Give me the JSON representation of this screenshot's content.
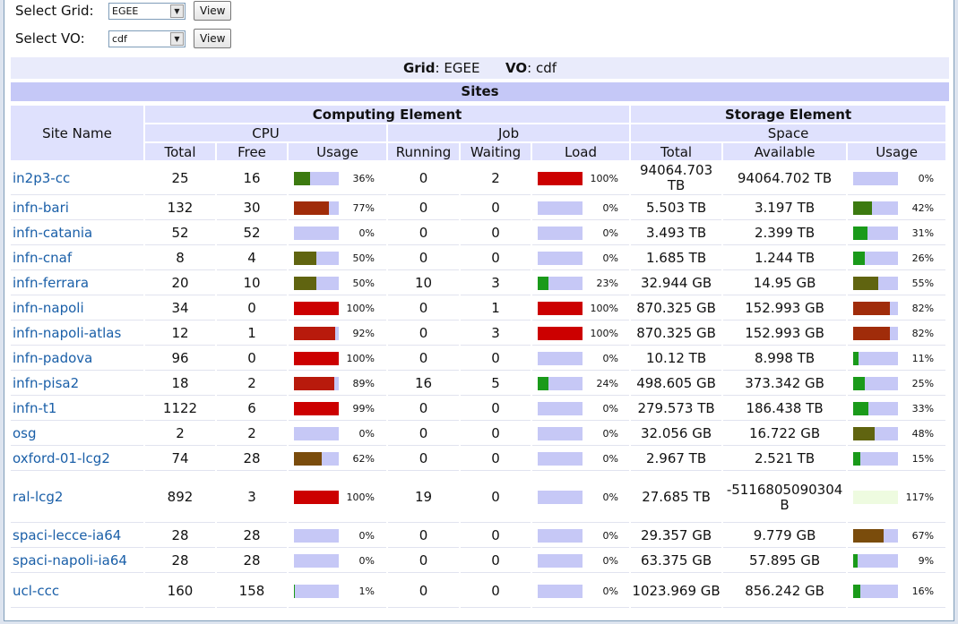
{
  "controls": {
    "grid_label": "Select Grid:",
    "grid_value": "EGEE",
    "vo_label": "Select VO:",
    "vo_value": "cdf",
    "view_label": "View"
  },
  "summary": {
    "grid_key": "Grid",
    "grid_value": "EGEE",
    "vo_key": "VO",
    "vo_value": "cdf"
  },
  "sites_title": "Sites",
  "headers": {
    "site_name": "Site Name",
    "computing_element": "Computing Element",
    "storage_element": "Storage Element",
    "cpu": "CPU",
    "job": "Job",
    "space": "Space",
    "cpu_total": "Total",
    "cpu_free": "Free",
    "cpu_usage": "Usage",
    "job_running": "Running",
    "job_waiting": "Waiting",
    "job_load": "Load",
    "space_total": "Total",
    "space_available": "Available",
    "space_usage": "Usage"
  },
  "rows": [
    {
      "site": "in2p3-cc",
      "total": "25",
      "free": "16",
      "usage": 36,
      "usage_label": "36%",
      "running": "0",
      "waiting": "2",
      "load": 100,
      "load_label": "100%",
      "space_total": "94064.703 TB",
      "space_avail": "94064.702 TB",
      "space_usage": 0,
      "space_usage_label": "0%"
    },
    {
      "site": "infn-bari",
      "total": "132",
      "free": "30",
      "usage": 77,
      "usage_label": "77%",
      "running": "0",
      "waiting": "0",
      "load": 0,
      "load_label": "0%",
      "space_total": "5.503 TB",
      "space_avail": "3.197 TB",
      "space_usage": 42,
      "space_usage_label": "42%"
    },
    {
      "site": "infn-catania",
      "total": "52",
      "free": "52",
      "usage": 0,
      "usage_label": "0%",
      "running": "0",
      "waiting": "0",
      "load": 0,
      "load_label": "0%",
      "space_total": "3.493 TB",
      "space_avail": "2.399 TB",
      "space_usage": 31,
      "space_usage_label": "31%"
    },
    {
      "site": "infn-cnaf",
      "total": "8",
      "free": "4",
      "usage": 50,
      "usage_label": "50%",
      "running": "0",
      "waiting": "0",
      "load": 0,
      "load_label": "0%",
      "space_total": "1.685 TB",
      "space_avail": "1.244 TB",
      "space_usage": 26,
      "space_usage_label": "26%"
    },
    {
      "site": "infn-ferrara",
      "total": "20",
      "free": "10",
      "usage": 50,
      "usage_label": "50%",
      "running": "10",
      "waiting": "3",
      "load": 23,
      "load_label": "23%",
      "space_total": "32.944 GB",
      "space_avail": "14.95 GB",
      "space_usage": 55,
      "space_usage_label": "55%"
    },
    {
      "site": "infn-napoli",
      "total": "34",
      "free": "0",
      "usage": 100,
      "usage_label": "100%",
      "running": "0",
      "waiting": "1",
      "load": 100,
      "load_label": "100%",
      "space_total": "870.325 GB",
      "space_avail": "152.993 GB",
      "space_usage": 82,
      "space_usage_label": "82%"
    },
    {
      "site": "infn-napoli-atlas",
      "total": "12",
      "free": "1",
      "usage": 92,
      "usage_label": "92%",
      "running": "0",
      "waiting": "3",
      "load": 100,
      "load_label": "100%",
      "space_total": "870.325 GB",
      "space_avail": "152.993 GB",
      "space_usage": 82,
      "space_usage_label": "82%"
    },
    {
      "site": "infn-padova",
      "total": "96",
      "free": "0",
      "usage": 100,
      "usage_label": "100%",
      "running": "0",
      "waiting": "0",
      "load": 0,
      "load_label": "0%",
      "space_total": "10.12 TB",
      "space_avail": "8.998 TB",
      "space_usage": 11,
      "space_usage_label": "11%"
    },
    {
      "site": "infn-pisa2",
      "total": "18",
      "free": "2",
      "usage": 89,
      "usage_label": "89%",
      "running": "16",
      "waiting": "5",
      "load": 24,
      "load_label": "24%",
      "space_total": "498.605 GB",
      "space_avail": "373.342 GB",
      "space_usage": 25,
      "space_usage_label": "25%"
    },
    {
      "site": "infn-t1",
      "total": "1122",
      "free": "6",
      "usage": 99,
      "usage_label": "99%",
      "running": "0",
      "waiting": "0",
      "load": 0,
      "load_label": "0%",
      "space_total": "279.573 TB",
      "space_avail": "186.438 TB",
      "space_usage": 33,
      "space_usage_label": "33%"
    },
    {
      "site": "osg",
      "total": "2",
      "free": "2",
      "usage": 0,
      "usage_label": "0%",
      "running": "0",
      "waiting": "0",
      "load": 0,
      "load_label": "0%",
      "space_total": "32.056 GB",
      "space_avail": "16.722 GB",
      "space_usage": 48,
      "space_usage_label": "48%"
    },
    {
      "site": "oxford-01-lcg2",
      "total": "74",
      "free": "28",
      "usage": 62,
      "usage_label": "62%",
      "running": "0",
      "waiting": "0",
      "load": 0,
      "load_label": "0%",
      "space_total": "2.967 TB",
      "space_avail": "2.521 TB",
      "space_usage": 15,
      "space_usage_label": "15%"
    },
    {
      "site": "ral-lcg2",
      "total": "892",
      "free": "3",
      "usage": 100,
      "usage_label": "100%",
      "running": "19",
      "waiting": "0",
      "load": 0,
      "load_label": "0%",
      "space_total": "27.685 TB",
      "space_avail": "-5116805090304 B",
      "space_usage": 117,
      "space_usage_label": "117%"
    },
    {
      "site": "spaci-lecce-ia64",
      "total": "28",
      "free": "28",
      "usage": 0,
      "usage_label": "0%",
      "running": "0",
      "waiting": "0",
      "load": 0,
      "load_label": "0%",
      "space_total": "29.357 GB",
      "space_avail": "9.779 GB",
      "space_usage": 67,
      "space_usage_label": "67%"
    },
    {
      "site": "spaci-napoli-ia64",
      "total": "28",
      "free": "28",
      "usage": 0,
      "usage_label": "0%",
      "running": "0",
      "waiting": "0",
      "load": 0,
      "load_label": "0%",
      "space_total": "63.375 GB",
      "space_avail": "57.895 GB",
      "space_usage": 9,
      "space_usage_label": "9%"
    },
    {
      "site": "ucl-ccc",
      "total": "160",
      "free": "158",
      "usage": 1,
      "usage_label": "1%",
      "running": "0",
      "waiting": "0",
      "load": 0,
      "load_label": "0%",
      "space_total": "1023.969 GB",
      "space_avail": "856.242 GB",
      "space_usage": 16,
      "space_usage_label": "16%"
    }
  ],
  "colors": {
    "bar_track": "#c6c8f6",
    "overflow_track": "#eefbe0",
    "link": "#1a5fa8",
    "header_bg": "#dfe1fd",
    "sites_bg": "#c5c8f7"
  }
}
